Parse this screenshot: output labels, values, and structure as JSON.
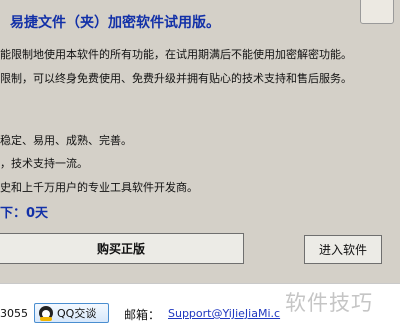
{
  "dialog": {
    "title": "易捷文件（夹）加密软件试用版。",
    "lines": [
      "能限制地使用本软件的所有功能，在试用期满后不能使用加密解密功能。",
      "限制，可以终身免费使用、免费升级并拥有贴心的技术支持和售后服务。",
      "稳定、易用、成熟、完善。",
      "，技术支持一流。",
      "史和上千万用户的专业工具软件开发商。"
    ],
    "trial_remaining": "下：0天"
  },
  "buttons": {
    "buy": "购买正版",
    "enter": "进入软件"
  },
  "footer": {
    "number_fragment": "3055",
    "qq_label": "QQ交谈",
    "email_label": "邮箱：",
    "email_link": "Support@YiJieJiaMi.c"
  },
  "watermark": "软件技巧"
}
